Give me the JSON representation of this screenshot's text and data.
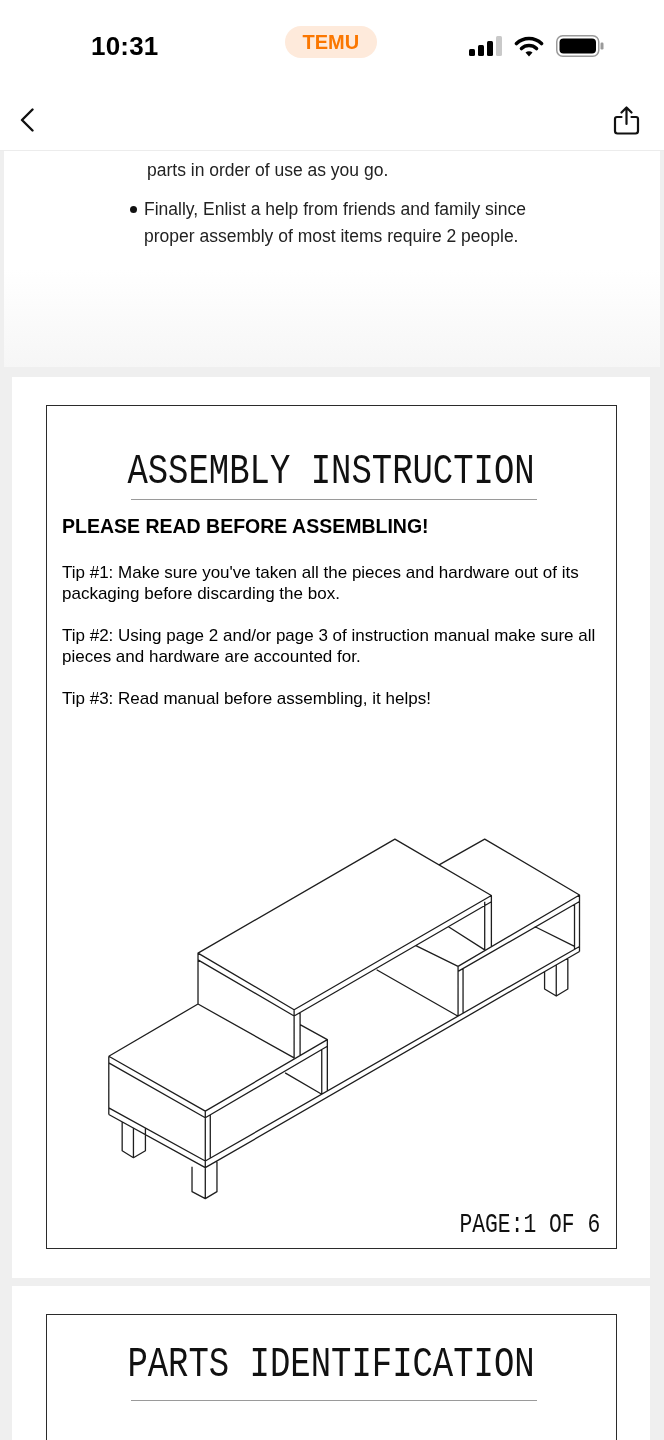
{
  "status_bar": {
    "time": "10:31",
    "app_badge": "TEMU"
  },
  "previous_page": {
    "paragraphs": [
      {
        "kind": "text",
        "text": "parts in order of use as you go."
      },
      {
        "kind": "bullet",
        "text": "Finally, Enlist a help from friends and family since proper assembly of most items require 2 people."
      }
    ]
  },
  "manual_page": {
    "title": "ASSEMBLY INSTRUCTION",
    "heading": "PLEASE READ BEFORE ASSEMBLING!",
    "tips": [
      "Tip #1: Make sure you've taken all the pieces and hardware out of its packaging before discarding the box.",
      "Tip #2: Using page 2 and/or page 3 of instruction manual make sure all pieces and hardware are accounted for.",
      "Tip #3: Read manual before assembling, it helps!"
    ],
    "page_number": "PAGE:1 OF 6"
  },
  "next_page": {
    "title": "PARTS IDENTIFICATION"
  }
}
